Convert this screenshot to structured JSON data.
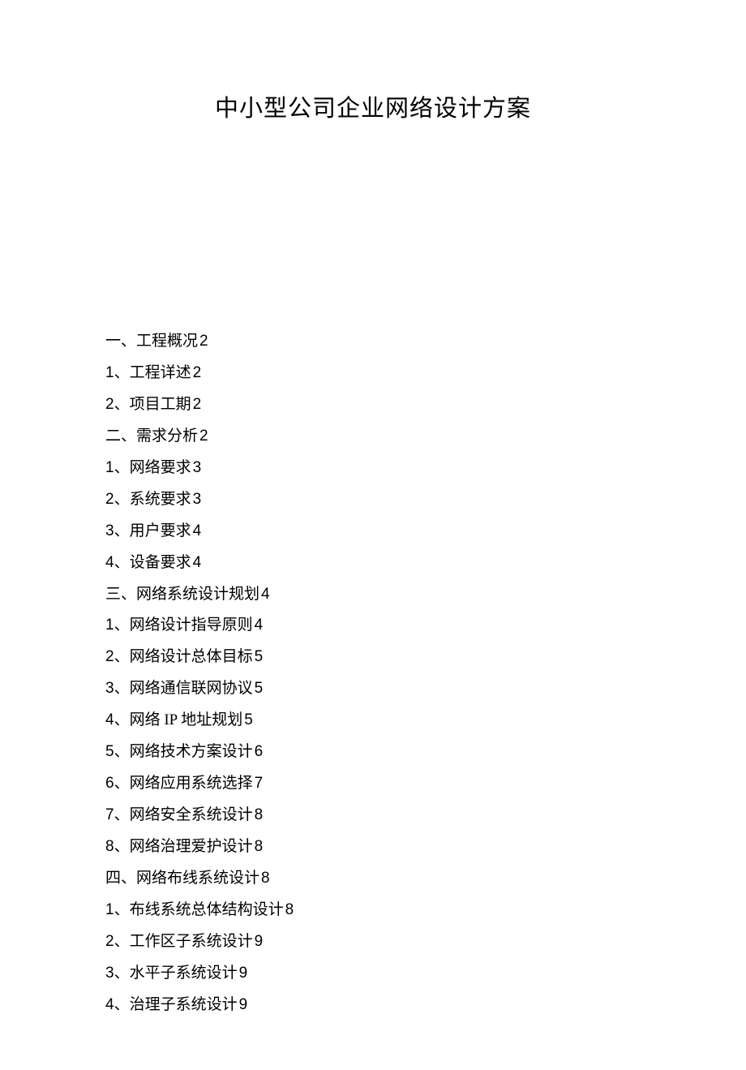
{
  "title": "中小型公司企业网络设计方案",
  "toc": [
    {
      "prefix": "一、",
      "label": "工程概况",
      "page": "2"
    },
    {
      "prefix": "1、",
      "label": "工程详述",
      "page": "2"
    },
    {
      "prefix": "2、",
      "label": "项目工期",
      "page": "2"
    },
    {
      "prefix": "二、",
      "label": "需求分析",
      "page": "2"
    },
    {
      "prefix": "1、",
      "label": "网络要求",
      "page": "3"
    },
    {
      "prefix": "2、",
      "label": "系统要求",
      "page": "3"
    },
    {
      "prefix": "3、",
      "label": "用户要求",
      "page": "4"
    },
    {
      "prefix": "4、",
      "label": "设备要求",
      "page": "4"
    },
    {
      "prefix": "三、",
      "label": "网络系统设计规划",
      "page": "4"
    },
    {
      "prefix": "1、",
      "label": "网络设计指导原则",
      "page": "4"
    },
    {
      "prefix": "2、",
      "label": "网络设计总体目标",
      "page": "5"
    },
    {
      "prefix": "3、",
      "label": "网络通信联网协议",
      "page": "5"
    },
    {
      "prefix": "4、",
      "label": "网络 IP 地址规划",
      "page": "5"
    },
    {
      "prefix": "5、",
      "label": "网络技术方案设计",
      "page": "6"
    },
    {
      "prefix": "6、",
      "label": "网络应用系统选择",
      "page": "7"
    },
    {
      "prefix": "7、",
      "label": "网络安全系统设计",
      "page": "8"
    },
    {
      "prefix": "8、",
      "label": "网络治理爱护设计",
      "page": "8"
    },
    {
      "prefix": "四、",
      "label": "网络布线系统设计",
      "page": "8"
    },
    {
      "prefix": "1、",
      "label": "布线系统总体结构设计",
      "page": "8"
    },
    {
      "prefix": "2、",
      "label": "工作区子系统设计",
      "page": "9"
    },
    {
      "prefix": "3、",
      "label": "水平子系统设计",
      "page": "9"
    },
    {
      "prefix": "4、",
      "label": "治理子系统设计",
      "page": "9"
    }
  ]
}
